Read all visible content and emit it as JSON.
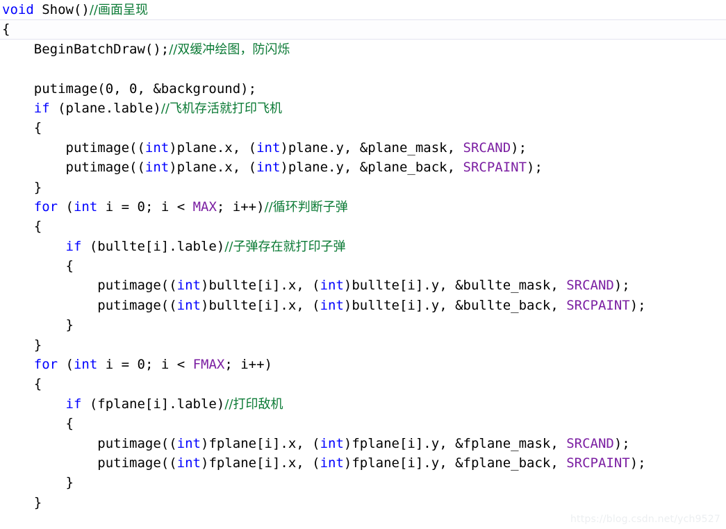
{
  "editor": {
    "language": "C++",
    "colors": {
      "background": "#ffffff",
      "plain_text": "#000000",
      "keyword": "#0000ff",
      "macro": "#7b1fa2",
      "comment": "#0b7a35",
      "current_line_border": "#e4e4ef"
    },
    "current_line_number": 2,
    "lines": [
      {
        "n": 1,
        "indent": 0,
        "current": false,
        "tokens": [
          {
            "t": "void",
            "c": "kw"
          },
          {
            "t": " Show()",
            "c": "plain"
          },
          {
            "t": "//画面呈现",
            "c": "comment"
          }
        ]
      },
      {
        "n": 2,
        "indent": 0,
        "current": true,
        "tokens": [
          {
            "t": "{",
            "c": "plain"
          }
        ]
      },
      {
        "n": 3,
        "indent": 1,
        "current": false,
        "tokens": [
          {
            "t": "BeginBatchDraw();",
            "c": "plain"
          },
          {
            "t": "//双缓冲绘图，防闪烁",
            "c": "comment"
          }
        ]
      },
      {
        "n": 4,
        "indent": 0,
        "current": false,
        "tokens": []
      },
      {
        "n": 5,
        "indent": 1,
        "current": false,
        "tokens": [
          {
            "t": "putimage(0, 0, &background);",
            "c": "plain"
          }
        ]
      },
      {
        "n": 6,
        "indent": 1,
        "current": false,
        "tokens": [
          {
            "t": "if",
            "c": "kw"
          },
          {
            "t": " (plane.lable)",
            "c": "plain"
          },
          {
            "t": "//飞机存活就打印飞机",
            "c": "comment"
          }
        ]
      },
      {
        "n": 7,
        "indent": 1,
        "current": false,
        "tokens": [
          {
            "t": "{",
            "c": "plain"
          }
        ]
      },
      {
        "n": 8,
        "indent": 2,
        "current": false,
        "tokens": [
          {
            "t": "putimage((",
            "c": "plain"
          },
          {
            "t": "int",
            "c": "kw"
          },
          {
            "t": ")plane.x, (",
            "c": "plain"
          },
          {
            "t": "int",
            "c": "kw"
          },
          {
            "t": ")plane.y, &plane_mask, ",
            "c": "plain"
          },
          {
            "t": "SRCAND",
            "c": "macro"
          },
          {
            "t": ");",
            "c": "plain"
          }
        ]
      },
      {
        "n": 9,
        "indent": 2,
        "current": false,
        "tokens": [
          {
            "t": "putimage((",
            "c": "plain"
          },
          {
            "t": "int",
            "c": "kw"
          },
          {
            "t": ")plane.x, (",
            "c": "plain"
          },
          {
            "t": "int",
            "c": "kw"
          },
          {
            "t": ")plane.y, &plane_back, ",
            "c": "plain"
          },
          {
            "t": "SRCPAINT",
            "c": "macro"
          },
          {
            "t": ");",
            "c": "plain"
          }
        ]
      },
      {
        "n": 10,
        "indent": 1,
        "current": false,
        "tokens": [
          {
            "t": "}",
            "c": "plain"
          }
        ]
      },
      {
        "n": 11,
        "indent": 1,
        "current": false,
        "tokens": [
          {
            "t": "for",
            "c": "kw"
          },
          {
            "t": " (",
            "c": "plain"
          },
          {
            "t": "int",
            "c": "kw"
          },
          {
            "t": " i = 0; i < ",
            "c": "plain"
          },
          {
            "t": "MAX",
            "c": "macro"
          },
          {
            "t": "; i++)",
            "c": "plain"
          },
          {
            "t": "//循环判断子弹",
            "c": "comment"
          }
        ]
      },
      {
        "n": 12,
        "indent": 1,
        "current": false,
        "tokens": [
          {
            "t": "{",
            "c": "plain"
          }
        ]
      },
      {
        "n": 13,
        "indent": 2,
        "current": false,
        "tokens": [
          {
            "t": "if",
            "c": "kw"
          },
          {
            "t": " (bullte[i].lable)",
            "c": "plain"
          },
          {
            "t": "//子弹存在就打印子弹",
            "c": "comment"
          }
        ]
      },
      {
        "n": 14,
        "indent": 2,
        "current": false,
        "tokens": [
          {
            "t": "{",
            "c": "plain"
          }
        ]
      },
      {
        "n": 15,
        "indent": 3,
        "current": false,
        "tokens": [
          {
            "t": "putimage((",
            "c": "plain"
          },
          {
            "t": "int",
            "c": "kw"
          },
          {
            "t": ")bullte[i].x, (",
            "c": "plain"
          },
          {
            "t": "int",
            "c": "kw"
          },
          {
            "t": ")bullte[i].y, &bullte_mask, ",
            "c": "plain"
          },
          {
            "t": "SRCAND",
            "c": "macro"
          },
          {
            "t": ");",
            "c": "plain"
          }
        ]
      },
      {
        "n": 16,
        "indent": 3,
        "current": false,
        "tokens": [
          {
            "t": "putimage((",
            "c": "plain"
          },
          {
            "t": "int",
            "c": "kw"
          },
          {
            "t": ")bullte[i].x, (",
            "c": "plain"
          },
          {
            "t": "int",
            "c": "kw"
          },
          {
            "t": ")bullte[i].y, &bullte_back, ",
            "c": "plain"
          },
          {
            "t": "SRCPAINT",
            "c": "macro"
          },
          {
            "t": ");",
            "c": "plain"
          }
        ]
      },
      {
        "n": 17,
        "indent": 2,
        "current": false,
        "tokens": [
          {
            "t": "}",
            "c": "plain"
          }
        ]
      },
      {
        "n": 18,
        "indent": 1,
        "current": false,
        "tokens": [
          {
            "t": "}",
            "c": "plain"
          }
        ]
      },
      {
        "n": 19,
        "indent": 1,
        "current": false,
        "tokens": [
          {
            "t": "for",
            "c": "kw"
          },
          {
            "t": " (",
            "c": "plain"
          },
          {
            "t": "int",
            "c": "kw"
          },
          {
            "t": " i = 0; i < ",
            "c": "plain"
          },
          {
            "t": "FMAX",
            "c": "macro"
          },
          {
            "t": "; i++)",
            "c": "plain"
          }
        ]
      },
      {
        "n": 20,
        "indent": 1,
        "current": false,
        "tokens": [
          {
            "t": "{",
            "c": "plain"
          }
        ]
      },
      {
        "n": 21,
        "indent": 2,
        "current": false,
        "tokens": [
          {
            "t": "if",
            "c": "kw"
          },
          {
            "t": " (fplane[i].lable)",
            "c": "plain"
          },
          {
            "t": "//打印敌机",
            "c": "comment"
          }
        ]
      },
      {
        "n": 22,
        "indent": 2,
        "current": false,
        "tokens": [
          {
            "t": "{",
            "c": "plain"
          }
        ]
      },
      {
        "n": 23,
        "indent": 3,
        "current": false,
        "tokens": [
          {
            "t": "putimage((",
            "c": "plain"
          },
          {
            "t": "int",
            "c": "kw"
          },
          {
            "t": ")fplane[i].x, (",
            "c": "plain"
          },
          {
            "t": "int",
            "c": "kw"
          },
          {
            "t": ")fplane[i].y, &fplane_mask, ",
            "c": "plain"
          },
          {
            "t": "SRCAND",
            "c": "macro"
          },
          {
            "t": ");",
            "c": "plain"
          }
        ]
      },
      {
        "n": 24,
        "indent": 3,
        "current": false,
        "tokens": [
          {
            "t": "putimage((",
            "c": "plain"
          },
          {
            "t": "int",
            "c": "kw"
          },
          {
            "t": ")fplane[i].x, (",
            "c": "plain"
          },
          {
            "t": "int",
            "c": "kw"
          },
          {
            "t": ")fplane[i].y, &fplane_back, ",
            "c": "plain"
          },
          {
            "t": "SRCPAINT",
            "c": "macro"
          },
          {
            "t": ");",
            "c": "plain"
          }
        ]
      },
      {
        "n": 25,
        "indent": 2,
        "current": false,
        "tokens": [
          {
            "t": "}",
            "c": "plain"
          }
        ]
      },
      {
        "n": 26,
        "indent": 1,
        "current": false,
        "tokens": [
          {
            "t": "}",
            "c": "plain"
          }
        ]
      }
    ]
  },
  "watermark": {
    "text": "https://blog.csdn.net/ych9527"
  }
}
